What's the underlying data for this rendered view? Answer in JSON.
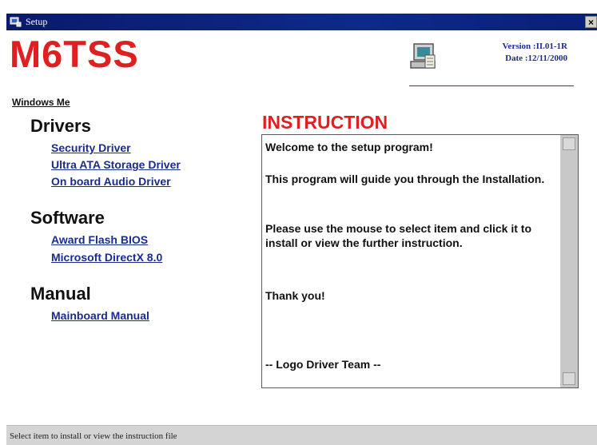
{
  "window": {
    "title": "Setup",
    "close_label": "×"
  },
  "app": {
    "title": "M6TSS"
  },
  "version": {
    "version_text": "Version :II.01-1R",
    "date_text": "Date :12/11/2000"
  },
  "nav": {
    "os_label": "Windows Me",
    "sections": [
      {
        "heading": "Drivers",
        "links": [
          "Security Driver",
          "Ultra ATA Storage Driver",
          "On board Audio Driver"
        ]
      },
      {
        "heading": "Software",
        "links": [
          "Award Flash BIOS",
          "Microsoft DirectX 8.0"
        ]
      },
      {
        "heading": "Manual",
        "links": [
          "Mainboard Manual"
        ]
      }
    ]
  },
  "instruction": {
    "heading": "INSTRUCTION",
    "paragraphs": [
      "Welcome to the setup program!",
      "This program will guide you through the Installation.",
      "Please use the mouse to select item and click it to install or view the further instruction.",
      "Thank you!",
      "-- Logo Driver Team --"
    ]
  },
  "status": {
    "text": "Select item to install or view the instruction file"
  },
  "colors": {
    "accent_red": "#e02020",
    "link_blue": "#1a2b8f",
    "titlebar": "#0a1a6b"
  }
}
